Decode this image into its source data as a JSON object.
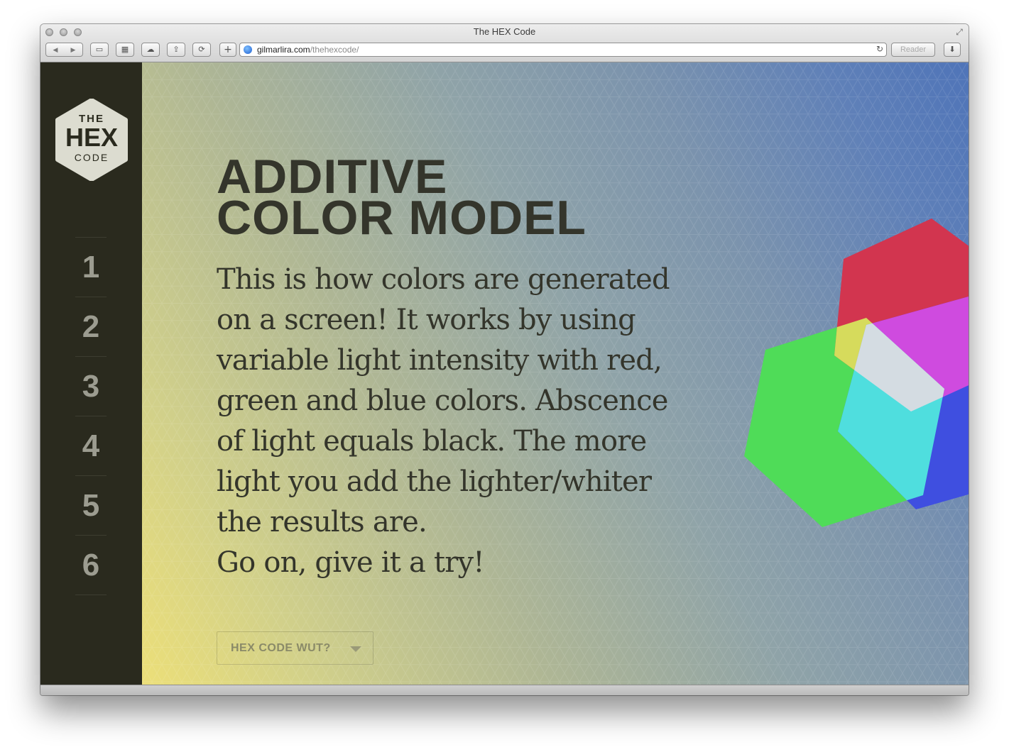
{
  "window": {
    "title": "The HEX Code"
  },
  "toolbar": {
    "back_icon": "chevron-left-icon",
    "forward_icon": "chevron-right-icon",
    "url_host": "gilmarlira.com",
    "url_path": "/thehexcode/",
    "reader_label": "Reader"
  },
  "logo": {
    "line1": "THE",
    "line2": "HEX",
    "line3": "CODE"
  },
  "nav": {
    "items": [
      "1",
      "2",
      "3",
      "4",
      "5",
      "6"
    ]
  },
  "content": {
    "headline_line1": "ADDITIVE",
    "headline_line2": "COLOR MODEL",
    "body": "This is how colors are generated on a screen! It works by using variable light intensity with red, green and blue colors. Abscence of light equals black. The more light you add the lighter/whiter the results are.",
    "cta_line": "Go on, give it a try!",
    "button_label": "HEX CODE WUT?"
  },
  "colors": {
    "sidebar": "#2a2a1e",
    "text": "#34352b",
    "red": "#d2354f",
    "green": "#4fdc58",
    "blue": "#3f4fe0",
    "yellow": "#d6db5c",
    "magenta": "#cf4bdf",
    "cyan": "#4fdede",
    "white": "#d4dce2"
  }
}
